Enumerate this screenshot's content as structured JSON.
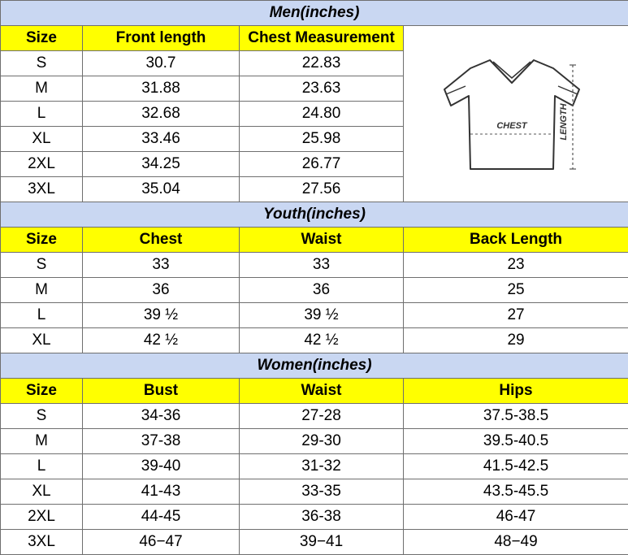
{
  "men": {
    "title": "Men(inches)",
    "headers": [
      "Size",
      "Front length",
      "Chest Measurement"
    ],
    "rows": [
      [
        "S",
        "30.7",
        "22.83"
      ],
      [
        "M",
        "31.88",
        "23.63"
      ],
      [
        "L",
        "32.68",
        "24.80"
      ],
      [
        "XL",
        "33.46",
        "25.98"
      ],
      [
        "2XL",
        "34.25",
        "26.77"
      ],
      [
        "3XL",
        "35.04",
        "27.56"
      ]
    ],
    "diagram": {
      "chest_label": "CHEST",
      "length_label": "LENGTH",
      "icon": "tshirt-icon"
    }
  },
  "youth": {
    "title": "Youth(inches)",
    "headers": [
      "Size",
      "Chest",
      "Waist",
      "Back Length"
    ],
    "rows": [
      [
        "S",
        "33",
        "33",
        "23"
      ],
      [
        "M",
        "36",
        "36",
        "25"
      ],
      [
        "L",
        "39 ½",
        "39 ½",
        "27"
      ],
      [
        "XL",
        "42 ½",
        "42 ½",
        "29"
      ]
    ]
  },
  "women": {
    "title": "Women(inches)",
    "headers": [
      "Size",
      "Bust",
      "Waist",
      "Hips"
    ],
    "rows": [
      [
        "S",
        "34-36",
        "27-28",
        "37.5-38.5"
      ],
      [
        "M",
        "37-38",
        "29-30",
        "39.5-40.5"
      ],
      [
        "L",
        "39-40",
        "31-32",
        "41.5-42.5"
      ],
      [
        "XL",
        "41-43",
        "33-35",
        "43.5-45.5"
      ],
      [
        "2XL",
        "44-45",
        "36-38",
        "46-47"
      ],
      [
        "3XL",
        "46−47",
        "39−41",
        "48−49"
      ]
    ]
  },
  "colors": {
    "section_header_bg": "#c9d7f2",
    "column_header_bg": "#ffff00",
    "border": "#6f6f6f"
  }
}
